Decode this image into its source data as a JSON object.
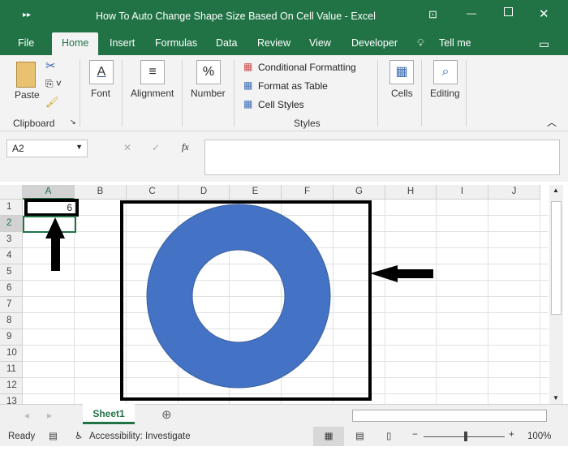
{
  "window": {
    "title": "How To Auto Change Shape Size Based On Cell Value  -  Excel"
  },
  "tabs": [
    "File",
    "Home",
    "Insert",
    "Formulas",
    "Data",
    "Review",
    "View",
    "Developer",
    "Tell me"
  ],
  "ribbon": {
    "paste": "Paste",
    "clipboard": "Clipboard",
    "font": "Font",
    "alignment": "Alignment",
    "number": "Number",
    "conditional": "Conditional Formatting",
    "format_table": "Format as Table",
    "cell_styles": "Cell Styles",
    "styles": "Styles",
    "cells": "Cells",
    "editing": "Editing"
  },
  "formula_bar": {
    "name_box": "A2",
    "fx": "fx",
    "value": ""
  },
  "columns": [
    "A",
    "B",
    "C",
    "D",
    "E",
    "F",
    "G",
    "H",
    "I",
    "J"
  ],
  "rows": [
    "1",
    "2",
    "3",
    "4",
    "5",
    "6",
    "7",
    "8",
    "9",
    "10",
    "11",
    "12",
    "13"
  ],
  "cells": {
    "A1": "6"
  },
  "shape": {
    "type": "donut",
    "fill": "#4472c4"
  },
  "sheets": [
    "Sheet1"
  ],
  "status": {
    "ready": "Ready",
    "accessibility": "Accessibility: Investigate",
    "zoom": "100%"
  },
  "colors": {
    "accent": "#217346"
  }
}
